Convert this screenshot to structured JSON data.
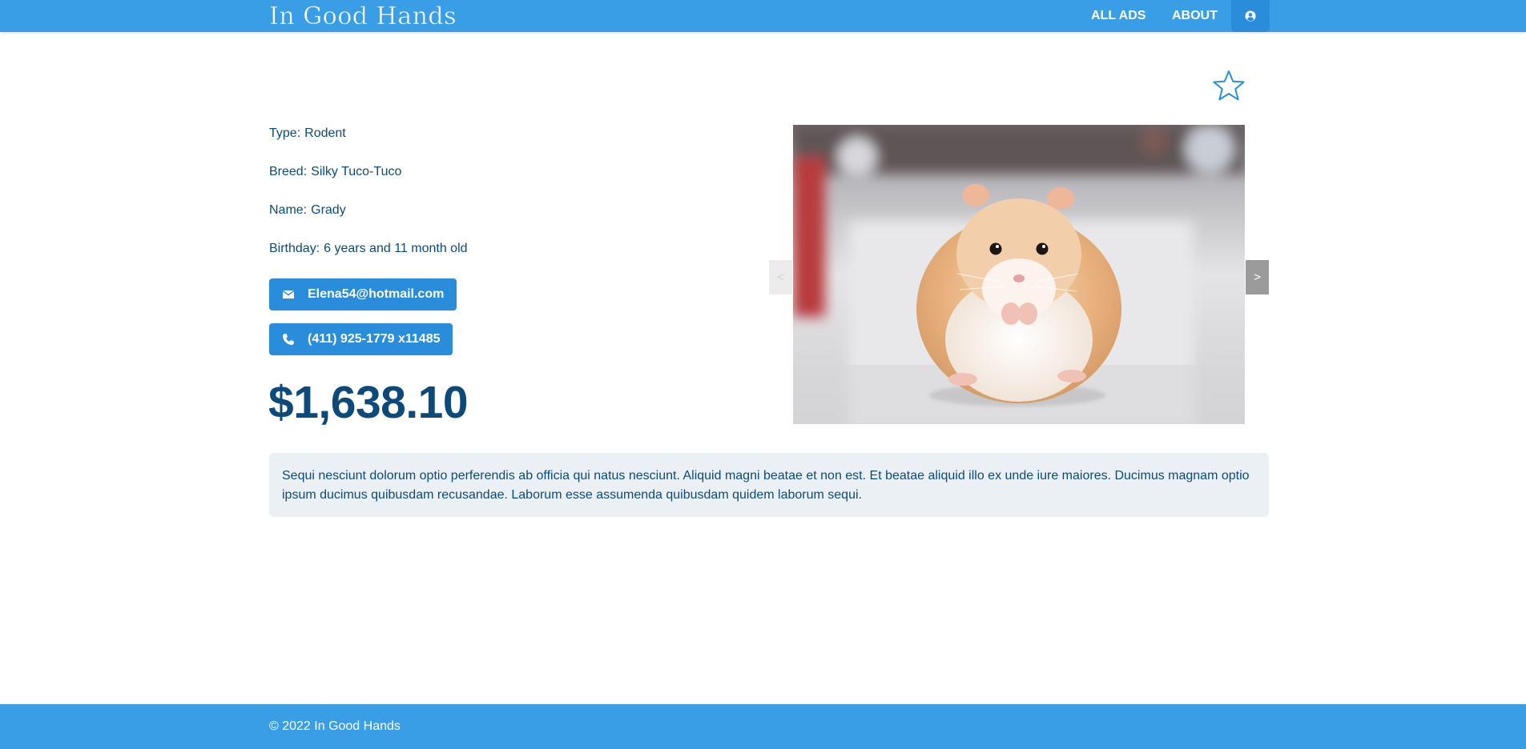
{
  "header": {
    "brand": "In Good Hands",
    "nav": {
      "all_ads": "ALL ADS",
      "about": "ABOUT"
    },
    "user_icon": "user-circle-icon"
  },
  "favorite": {
    "icon": "star-outline-icon",
    "active": false
  },
  "pet": {
    "type_label": "Type:",
    "type": "Rodent",
    "breed_label": "Breed:",
    "breed": "Silky Tuco-Tuco",
    "name_label": "Name:",
    "name": "Grady",
    "birthday_label": "Birthday:",
    "birthday": "6 years and 11 month old"
  },
  "contact": {
    "email": "Elena54@hotmail.com",
    "email_icon": "envelope-icon",
    "phone": "(411) 925-1779 x11485",
    "phone_icon": "phone-icon"
  },
  "price": "$1,638.10",
  "carousel": {
    "prev_label": "<",
    "next_label": ">"
  },
  "description": "Sequi nesciunt dolorum optio perferendis ab officia qui natus nesciunt. Aliquid magni beatae et non est. Et beatae aliquid illo ex unde iure maiores. Ducimus magnam optio ipsum ducimus quibusdam recusandae. Laborum esse assumenda quibusdam quidem laborum sequi.",
  "footer": {
    "copyright": "© 2022 In Good Hands"
  },
  "colors": {
    "primary": "#3a9ee6",
    "button": "#2a8ddc",
    "text": "#0d4a7a",
    "description_bg": "#ebf0f5"
  }
}
